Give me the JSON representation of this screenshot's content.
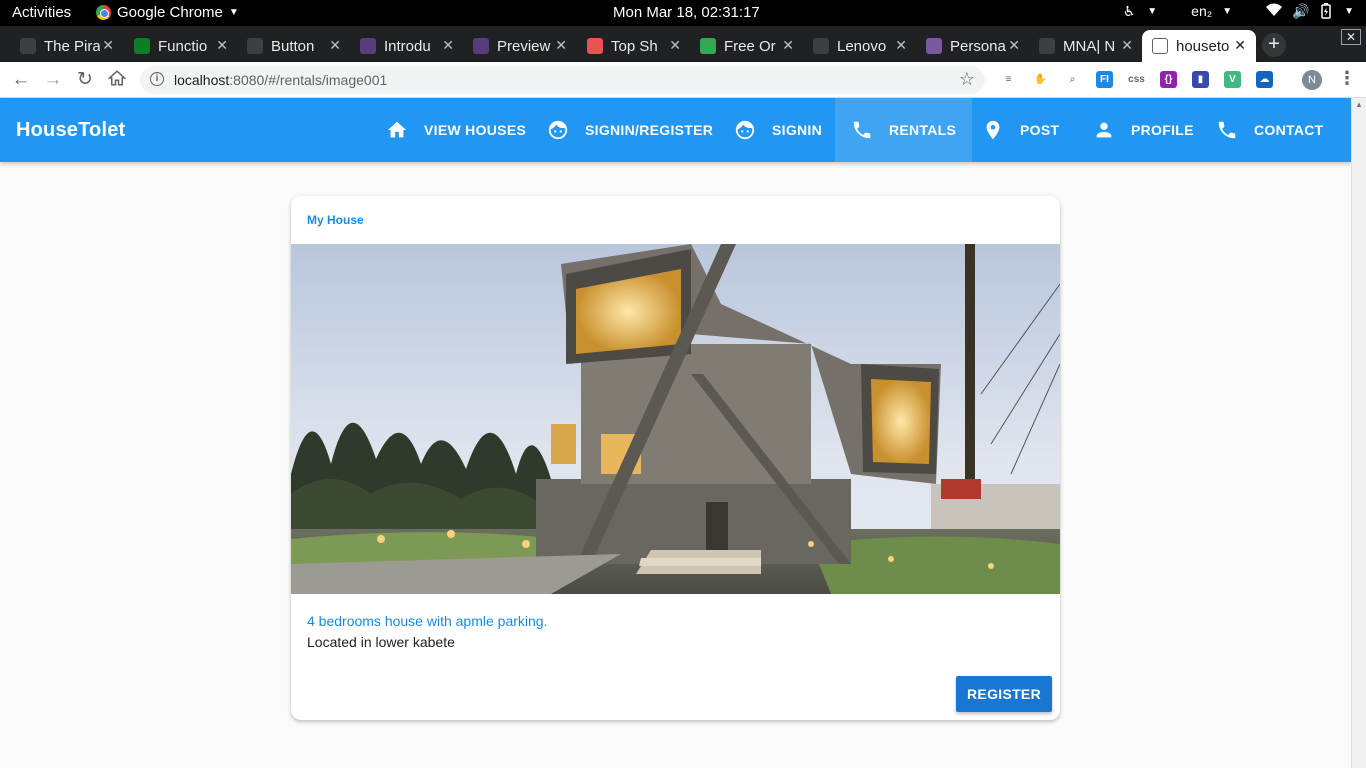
{
  "os_bar": {
    "activities": "Activities",
    "app_name": "Google Chrome",
    "clock": "Mon Mar 18, 02:31:17",
    "keyboard_layout": "en₂"
  },
  "browser": {
    "tabs": [
      {
        "title": "The Pira",
        "icon": "terminal-icon",
        "color": "#3c4043"
      },
      {
        "title": "Functio",
        "icon": "android-icon",
        "color": "#0f7d22"
      },
      {
        "title": "Button",
        "icon": "codepen-icon",
        "color": "#3c4043"
      },
      {
        "title": "Introdu",
        "icon": "bootstrap-icon",
        "color": "#563d7c"
      },
      {
        "title": "Preview",
        "icon": "bootstrap-icon",
        "color": "#563d7c"
      },
      {
        "title": "Top Sh",
        "icon": "udemy-icon",
        "color": "#ec5252"
      },
      {
        "title": "Free Or",
        "icon": "download-icon",
        "color": "#34a853"
      },
      {
        "title": "Lenovo",
        "icon": "lenovo-icon",
        "color": "#3c4043"
      },
      {
        "title": "Persona",
        "icon": "heroku-icon",
        "color": "#79589f"
      },
      {
        "title": "MNA| N",
        "icon": "page-icon",
        "color": "#3c4043"
      },
      {
        "title": "houseto",
        "icon": "page-icon",
        "color": "#ffffff"
      }
    ],
    "url_host": "localhost",
    "url_rest": ":8080/#/rentals/image001",
    "avatar_letter": "N",
    "extensions": [
      {
        "name": "reading-list-icon",
        "label": "≡",
        "color": "#5f6368"
      },
      {
        "name": "gnome-extension-icon",
        "label": "✋",
        "color": "#202124"
      },
      {
        "name": "search-extension-icon",
        "label": "⌕",
        "color": "#9aa0a6"
      },
      {
        "name": "fi-extension-icon",
        "label": "FI",
        "color": "#1e88e5"
      },
      {
        "name": "css-extension-icon",
        "label": "css",
        "color": "#5f6368"
      },
      {
        "name": "bracket-extension-icon",
        "label": "{}",
        "color": "#8e24aa"
      },
      {
        "name": "bookmark-extension-icon",
        "label": "▮",
        "color": "#3949ab"
      },
      {
        "name": "vue-devtools-icon",
        "label": "V",
        "color": "#41b883"
      },
      {
        "name": "cloud-extension-icon",
        "label": "☁",
        "color": "#1565c0"
      }
    ]
  },
  "app": {
    "brand": "HouseTolet",
    "nav": [
      {
        "label": "VIEW HOUSES",
        "icon": "home-icon"
      },
      {
        "label": "SIGNIN/REGISTER",
        "icon": "face-icon"
      },
      {
        "label": "SIGNIN",
        "icon": "face-icon"
      },
      {
        "label": "RENTALS",
        "icon": "phone-icon",
        "active": true
      },
      {
        "label": "POST",
        "icon": "location-pin-icon"
      },
      {
        "label": "PROFILE",
        "icon": "person-icon"
      },
      {
        "label": "CONTACT",
        "icon": "phone-icon"
      }
    ],
    "primary_color": "#2196f3"
  },
  "card": {
    "title": "My House",
    "image_alt": "modern concrete house photo",
    "subtitle": "4 bedrooms house with apmle parking.",
    "text": "Located in lower kabete",
    "button_label": "REGISTER",
    "accent_color": "#1e88e5"
  }
}
